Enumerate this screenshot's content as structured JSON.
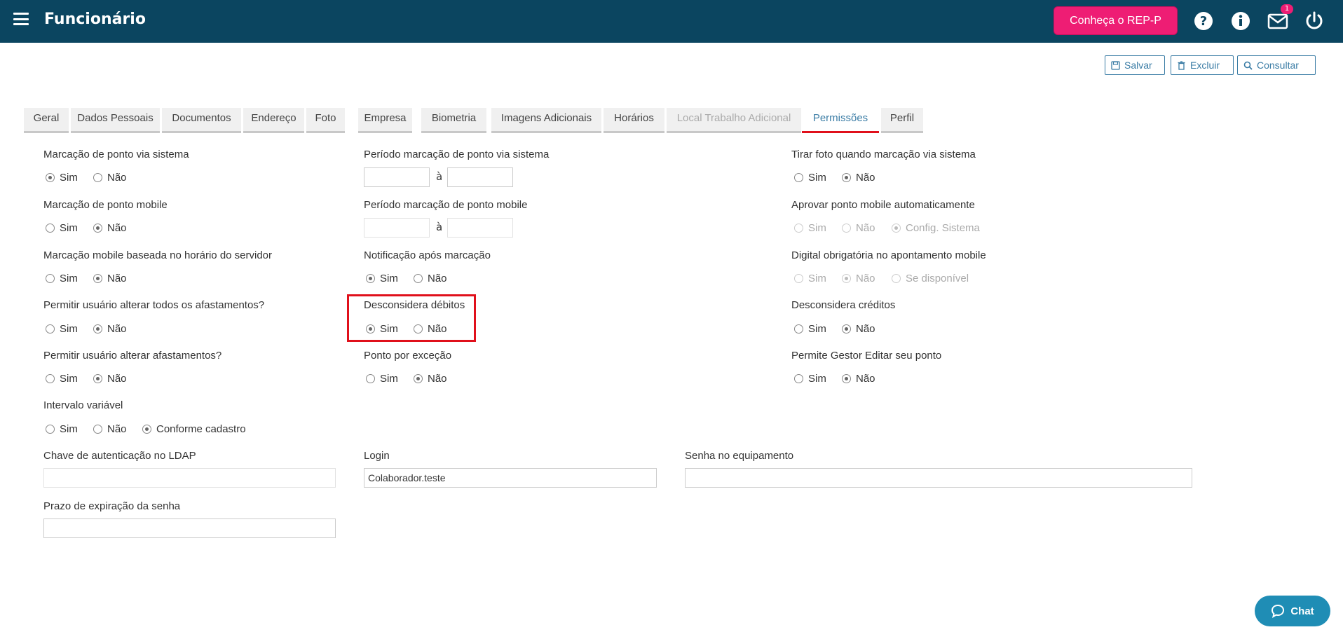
{
  "header": {
    "title": "Funcionário",
    "rep_button": "Conheça o REP-P",
    "notification_count": "1"
  },
  "toolbar": {
    "save": "Salvar",
    "delete": "Excluir",
    "search": "Consultar"
  },
  "tabs": [
    {
      "label": "Geral"
    },
    {
      "label": "Dados Pessoais"
    },
    {
      "label": "Documentos"
    },
    {
      "label": "Endereço"
    },
    {
      "label": "Foto"
    },
    {
      "label": "Empresa"
    },
    {
      "label": "Biometria"
    },
    {
      "label": "Imagens Adicionais"
    },
    {
      "label": "Horários"
    },
    {
      "label": "Local Trabalho Adicional",
      "disabled": true
    },
    {
      "label": "Permissões",
      "active": true
    },
    {
      "label": "Perfil"
    }
  ],
  "fields": {
    "marcacao_sistema": {
      "label": "Marcação de ponto via sistema",
      "options": [
        "Sim",
        "Não"
      ],
      "selected": "Sim"
    },
    "marcacao_mobile": {
      "label": "Marcação de ponto mobile",
      "options": [
        "Sim",
        "Não"
      ],
      "selected": "Não"
    },
    "mobile_horario_servidor": {
      "label": "Marcação mobile baseada no horário do servidor",
      "options": [
        "Sim",
        "Não"
      ],
      "selected": "Não"
    },
    "alterar_todos_afastamentos": {
      "label": "Permitir usuário alterar todos os afastamentos?",
      "options": [
        "Sim",
        "Não"
      ],
      "selected": "Não"
    },
    "alterar_afastamentos": {
      "label": "Permitir usuário alterar afastamentos?",
      "options": [
        "Sim",
        "Não"
      ],
      "selected": "Não"
    },
    "intervalo_variavel": {
      "label": "Intervalo variável",
      "options": [
        "Sim",
        "Não",
        "Conforme cadastro"
      ],
      "selected": "Conforme cadastro"
    },
    "periodo_sistema": {
      "label": "Período marcação de ponto via sistema",
      "separator": "à",
      "from": "",
      "to": ""
    },
    "periodo_mobile": {
      "label": "Período marcação de ponto mobile",
      "separator": "à",
      "from": "",
      "to": ""
    },
    "notificacao": {
      "label": "Notificação após marcação",
      "options": [
        "Sim",
        "Não"
      ],
      "selected": "Sim"
    },
    "desconsidera_debitos": {
      "label": "Desconsidera débitos",
      "options": [
        "Sim",
        "Não"
      ],
      "selected": "Sim"
    },
    "ponto_excecao": {
      "label": "Ponto por exceção",
      "options": [
        "Sim",
        "Não"
      ],
      "selected": "Não"
    },
    "tirar_foto": {
      "label": "Tirar foto quando marcação via sistema",
      "options": [
        "Sim",
        "Não"
      ],
      "selected": "Não"
    },
    "aprovar_mobile": {
      "label": "Aprovar ponto mobile automaticamente",
      "options": [
        "Sim",
        "Não",
        "Config. Sistema"
      ],
      "selected": "Config. Sistema",
      "disabled": true
    },
    "digital_obrigatoria": {
      "label": "Digital obrigatória no apontamento mobile",
      "options": [
        "Sim",
        "Não",
        "Se disponível"
      ],
      "selected": "Não",
      "disabled": true
    },
    "desconsidera_creditos": {
      "label": "Desconsidera créditos",
      "options": [
        "Sim",
        "Não"
      ],
      "selected": "Não"
    },
    "gestor_editar": {
      "label": "Permite Gestor Editar seu ponto",
      "options": [
        "Sim",
        "Não"
      ],
      "selected": "Não"
    },
    "ldap": {
      "label": "Chave de autenticação no LDAP",
      "value": ""
    },
    "login": {
      "label": "Login",
      "value": "Colaborador.teste"
    },
    "senha_equipamento": {
      "label": "Senha no equipamento",
      "value": ""
    },
    "prazo_senha": {
      "label": "Prazo de expiração da senha",
      "value": ""
    }
  },
  "chat": {
    "label": "Chat"
  },
  "colors": {
    "header": "#0b4560",
    "accent": "#ee1d74",
    "link": "#3a7ca5",
    "highlight": "#e0101b",
    "chat": "#1f8db5"
  }
}
